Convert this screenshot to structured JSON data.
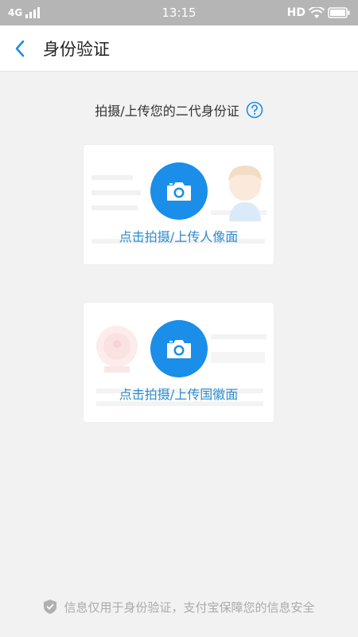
{
  "status_bar": {
    "network": "4G",
    "time": "13:15",
    "hd": "HD"
  },
  "nav": {
    "title": "身份验证",
    "back_icon": "chevron-left-icon"
  },
  "instruction": {
    "text": "拍摄/上传您的二代身份证",
    "help_icon": "question-circle-icon"
  },
  "cards": [
    {
      "label": "点击拍摄/上传人像面",
      "icon": "camera-icon"
    },
    {
      "label": "点击拍摄/上传国徽面",
      "icon": "camera-icon"
    }
  ],
  "footer": {
    "text": "信息仅用于身份验证，支付宝保障您的信息安全",
    "icon": "shield-icon"
  },
  "colors": {
    "accent": "#1a8ee8",
    "label": "#2b8ccf",
    "background": "#f2f2f2"
  }
}
